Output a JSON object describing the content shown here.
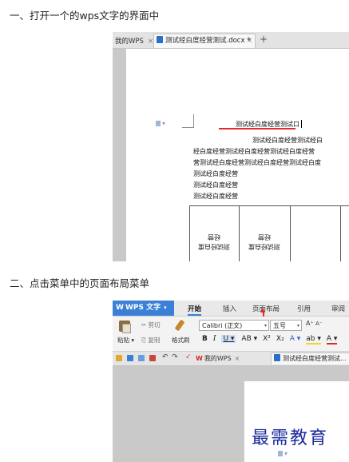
{
  "step1": {
    "title": "一、打开一个的wps文字的界面中"
  },
  "step2": {
    "title": "二、点击菜单中的页面布局菜单"
  },
  "shot1": {
    "tabs": {
      "home": "我的WPS",
      "home_close": "×",
      "doc": "测试经白度经营测试.docx *",
      "doc_close": "×",
      "new_tab": "+"
    },
    "doc": {
      "para_mark": "▾",
      "title": "测试经白度经营测试口",
      "lines": [
        "测试经白度经营测试经白",
        "经白度经营测试经白度经营测试经白度经营",
        "营测试经白度经营测试经白度经营测试经白度",
        "测试经白度经营",
        "测试经白度经营",
        "测试经白度经营"
      ],
      "table_cells": [
        "测试经白度经营",
        "测试经白度经营"
      ]
    }
  },
  "shot2": {
    "app_button": {
      "label": "WPS 文字",
      "logo": "W",
      "arrow": "▾"
    },
    "menu": {
      "home": "开始",
      "insert": "插入",
      "layout": "页面布局",
      "reference": "引用",
      "review": "审阅"
    },
    "ribbon": {
      "cut": "✂ 剪切",
      "copy": "⎘ 复制",
      "paste": "粘贴 ▾",
      "format_painter": "格式刷",
      "font": "Calibri (正文)",
      "font_size": "五号",
      "dropdown": "▾",
      "grow": "A⁺",
      "shrink": "A⁻",
      "format": {
        "bold": "B",
        "italic": "I",
        "underline": "U ▾",
        "strike": "AB ▾",
        "superscript": "X²",
        "subscript": "X₂",
        "effect": "A ▾",
        "highlight": "ab ▾",
        "font_color": "A ▾"
      }
    },
    "quickbar": {
      "undo": "↶",
      "redo": "↷",
      "check": "✓",
      "tab1": "我的WPS",
      "tab1_logo": "W",
      "tab1_close": "×",
      "tab2": "测试经白度经营测试..."
    },
    "doc": {
      "para_mark": "▾"
    },
    "watermark": "最需教育"
  }
}
